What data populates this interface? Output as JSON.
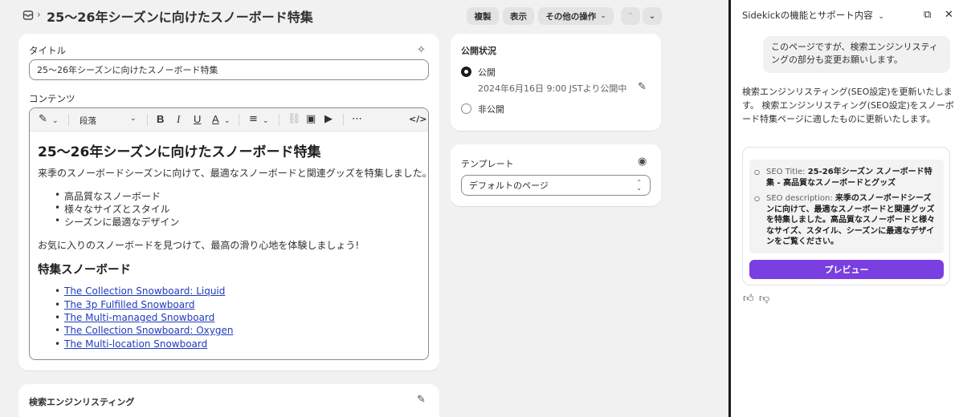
{
  "header": {
    "title": "25〜26年シーズンに向けたスノーボード特集",
    "breadcrumb_chevron": "›",
    "buttons": {
      "duplicate": "複製",
      "view": "表示",
      "more": "その他の操作"
    }
  },
  "title_card": {
    "label": "タイトル",
    "value": "25〜26年シーズンに向けたスノーボード特集",
    "content_label": "コンテンツ"
  },
  "editor": {
    "toolbar": {
      "paragraph": "段落"
    },
    "heading": "25〜26年シーズンに向けたスノーボード特集",
    "intro": "来季のスノーボードシーズンに向けて、最適なスノーボードと関連グッズを特集しました。",
    "bullets": [
      "高品質なスノーボード",
      "様々なサイズとスタイル",
      "シーズンに最適なデザイン"
    ],
    "closing": "お気に入りのスノーボードを見つけて、最高の滑り心地を体験しましょう!",
    "subheading": "特集スノーボード",
    "links": [
      "The Collection Snowboard: Liquid",
      "The 3p Fulfilled Snowboard",
      "The Multi-managed Snowboard",
      "The Collection Snowboard: Oxygen",
      "The Multi-location Snowboard"
    ]
  },
  "seo_card": {
    "label": "検索エンジンリスティング"
  },
  "visibility": {
    "title": "公開状況",
    "options": [
      {
        "label": "公開",
        "selected": true,
        "detail": "2024年6月16日 9:00 JSTより公開中"
      },
      {
        "label": "非公開",
        "selected": false
      }
    ]
  },
  "template": {
    "label": "テンプレート",
    "value": "デフォルトのページ"
  },
  "sidekick": {
    "title": "Sidekickの機能とサポート内容",
    "user_message": "このページですが、検索エンジンリスティングの部分も変更お願いします。",
    "reply": "検索エンジンリスティング(SEO設定)を更新いたします。 検索エンジンリスティング(SEO設定)をスノーボード特集ページに適したものに更新いたします。",
    "items": [
      {
        "key": "SEO Title:",
        "value": "25-26年シーズン スノーボード特集 - 高品質なスノーボードとグッズ"
      },
      {
        "key": "SEO description:",
        "value": "来季のスノーボードシーズンに向けて、最適なスノーボードと関連グッズを特集しました。高品質なスノーボードと様々なサイズ、スタイル、シーズンに最適なデザインをご覧ください。"
      }
    ],
    "preview_button": "プレビュー"
  },
  "colors": {
    "accent": "#7a3fe0",
    "link": "#1f3bbd",
    "background": "#f1f1f1"
  }
}
